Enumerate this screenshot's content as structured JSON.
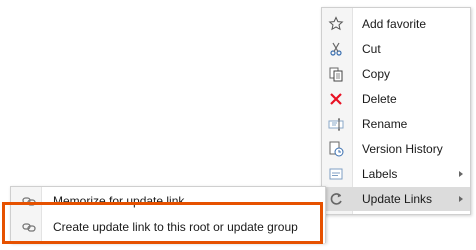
{
  "context_menu": {
    "items": [
      {
        "label": "Add favorite",
        "icon": "star-outline-icon"
      },
      {
        "label": "Cut",
        "icon": "scissors-icon"
      },
      {
        "label": "Copy",
        "icon": "copy-icon"
      },
      {
        "label": "Delete",
        "icon": "red-x-delete-icon"
      },
      {
        "label": "Rename",
        "icon": "rename-icon"
      },
      {
        "label": "Version History",
        "icon": "version-history-icon"
      },
      {
        "label": "Labels",
        "icon": "labels-icon",
        "submenu": true
      },
      {
        "label": "Update Links",
        "icon": "refresh-icon",
        "submenu": true
      }
    ]
  },
  "update_links_submenu": {
    "items": [
      {
        "label": "Memorize for update link",
        "icon": "link-icon"
      },
      {
        "label": "Create update link to this root or update group",
        "icon": "link-icon"
      }
    ]
  },
  "colors": {
    "delete_red": "#e81123",
    "highlight_border": "#e65100",
    "hover_bg": "#dcdcdc"
  }
}
